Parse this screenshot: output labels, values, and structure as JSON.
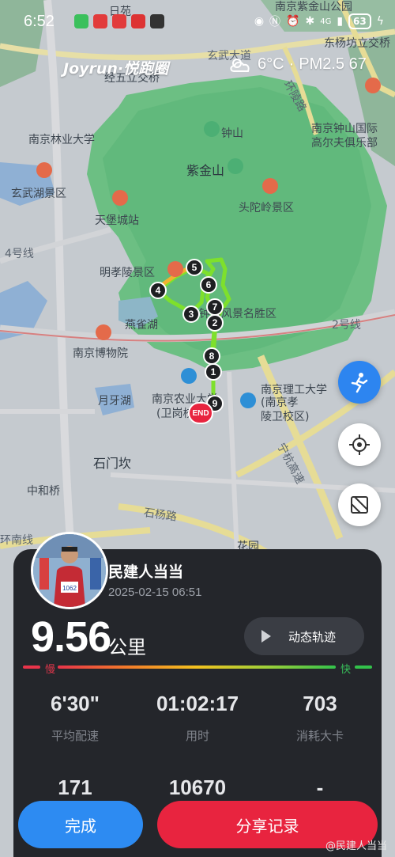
{
  "status_bar": {
    "time": "6:52",
    "network": "4G",
    "battery": "63"
  },
  "brand": "Joyrun·悦跑圈",
  "weather": {
    "temperature": "6°C",
    "separator": "·",
    "air_quality": "PM2.5 67"
  },
  "map": {
    "labels": [
      {
        "text": "日苑",
        "kind": "minor"
      },
      {
        "text": "南京紫金山公园",
        "kind": "minor"
      },
      {
        "text": "东杨坊立交桥",
        "kind": "minor"
      },
      {
        "text": "玄武大道",
        "kind": "road"
      },
      {
        "text": "经五立交桥",
        "kind": "minor"
      },
      {
        "text": "环陵路",
        "kind": "road"
      },
      {
        "text": "南京林业大学",
        "kind": "minor"
      },
      {
        "text": "钟山",
        "kind": "minor"
      },
      {
        "text": "南京钟山国际",
        "kind": "minor"
      },
      {
        "text": "高尔夫俱乐部",
        "kind": "minor"
      },
      {
        "text": "紫金山",
        "kind": "major"
      },
      {
        "text": "玄武湖景区",
        "kind": "minor"
      },
      {
        "text": "头陀岭景区",
        "kind": "minor"
      },
      {
        "text": "天堡城站",
        "kind": "minor"
      },
      {
        "text": "4号线",
        "kind": "road"
      },
      {
        "text": "明孝陵景区",
        "kind": "minor"
      },
      {
        "text": "钟山风景名胜区",
        "kind": "minor"
      },
      {
        "text": "燕雀湖",
        "kind": "minor"
      },
      {
        "text": "2号线",
        "kind": "road"
      },
      {
        "text": "南京博物院",
        "kind": "minor"
      },
      {
        "text": "月牙湖",
        "kind": "minor"
      },
      {
        "text": "南京农业大学",
        "kind": "minor"
      },
      {
        "text": "(卫岗校区)",
        "kind": "minor"
      },
      {
        "text": "南京理工大学",
        "kind": "minor"
      },
      {
        "text": "(南京孝",
        "kind": "minor"
      },
      {
        "text": "陵卫校区)",
        "kind": "minor"
      },
      {
        "text": "石门坎",
        "kind": "major"
      },
      {
        "text": "中和桥",
        "kind": "minor"
      },
      {
        "text": "石杨路",
        "kind": "road"
      },
      {
        "text": "宁杭高速",
        "kind": "road"
      },
      {
        "text": "环南线",
        "kind": "road"
      },
      {
        "text": "花园",
        "kind": "minor"
      }
    ],
    "route_markers": [
      "1",
      "2",
      "3",
      "4",
      "5",
      "6",
      "7",
      "8",
      "9"
    ],
    "end_label": "END"
  },
  "summary": {
    "username": "民建人当当",
    "datetime": "2025-02-15 06:51",
    "distance": "9.56",
    "distance_unit": "公里",
    "replay_label": "动态轨迹",
    "pace_slow": "慢",
    "pace_fast": "快",
    "bib_number": "1062",
    "stats": [
      {
        "value": "6'30\"",
        "label": "平均配速"
      },
      {
        "value": "01:02:17",
        "label": "用时"
      },
      {
        "value": "703",
        "label": "消耗大卡"
      },
      {
        "value": "171",
        "label": ""
      },
      {
        "value": "10670",
        "label": ""
      },
      {
        "value": "-",
        "label": ""
      }
    ]
  },
  "actions": {
    "done_label": "完成",
    "share_label": "分享记录"
  },
  "watermark": "@民建人当当",
  "colors": {
    "route_green": "#7ee02c",
    "done_blue": "#2d8bf2",
    "share_red": "#e8243f",
    "card_bg": "#24262b",
    "park_green": "#6fbf7a"
  }
}
